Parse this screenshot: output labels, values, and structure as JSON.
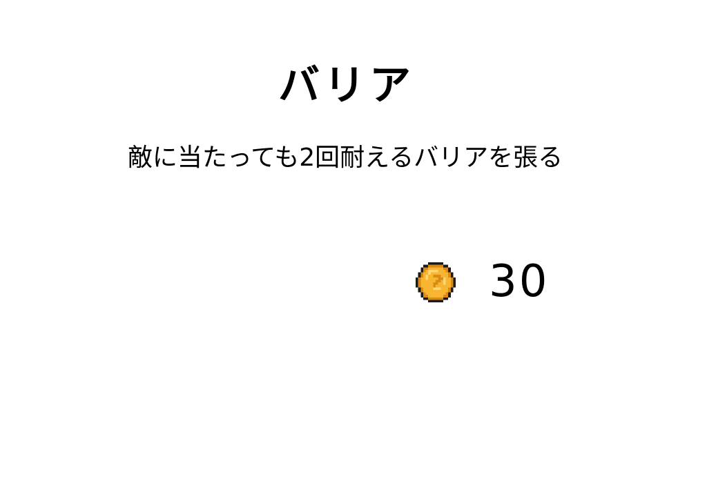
{
  "item": {
    "name": "バリア",
    "description": "敵に当たっても2回耐えるバリアを張る"
  },
  "price": {
    "icon": "coin-icon",
    "value": "30"
  },
  "colors": {
    "background": "#ffffff",
    "text": "#000000",
    "coin_fill": "#f7b531",
    "coin_highlight": "#ffd873",
    "coin_shadow": "#d98a14",
    "coin_outline": "#1a1a1a"
  }
}
